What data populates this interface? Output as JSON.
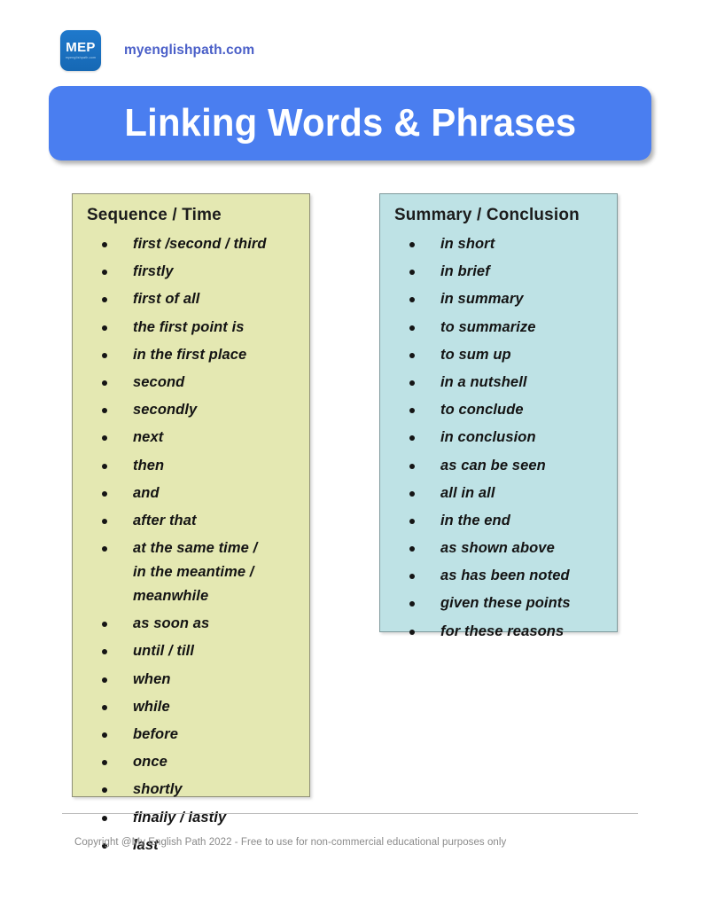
{
  "brand": {
    "logo_main": "MEP",
    "logo_sub": "myenglishpath.com",
    "logo_color": "#1a73c4",
    "url": "myenglishpath.com",
    "url_color": "#4a5fc8"
  },
  "banner": {
    "title": "Linking Words & Phrases",
    "background_color": "#4a7ef0",
    "text_color": "#ffffff"
  },
  "columns": [
    {
      "heading": "Sequence / Time",
      "background_color": "#e4e8b2",
      "border_color": "#8e8e78",
      "items": [
        "first /second / third",
        "firstly",
        "first of all",
        "the first point is",
        "in the first place",
        "second",
        "secondly",
        "next",
        "then",
        "and",
        "after that",
        "at the same time /\nin the meantime /\nmeanwhile",
        "as soon as",
        "until / till",
        "when",
        "while",
        "before",
        "once",
        "shortly",
        "finally / lastly",
        "last"
      ]
    },
    {
      "heading": "Summary / Conclusion",
      "background_color": "#bee2e5",
      "border_color": "#7f9a9c",
      "items": [
        "in short",
        "in brief",
        "in summary",
        "to summarize",
        "to sum up",
        "in a nutshell",
        "to conclude",
        "in conclusion",
        "as can be seen",
        "all in all",
        "in the end",
        "as shown above",
        "as has been noted",
        "given these points",
        "for these reasons"
      ]
    }
  ],
  "footer": {
    "text": "Copyright @My English Path 2022 - Free to use for non-commercial educational purposes only"
  }
}
